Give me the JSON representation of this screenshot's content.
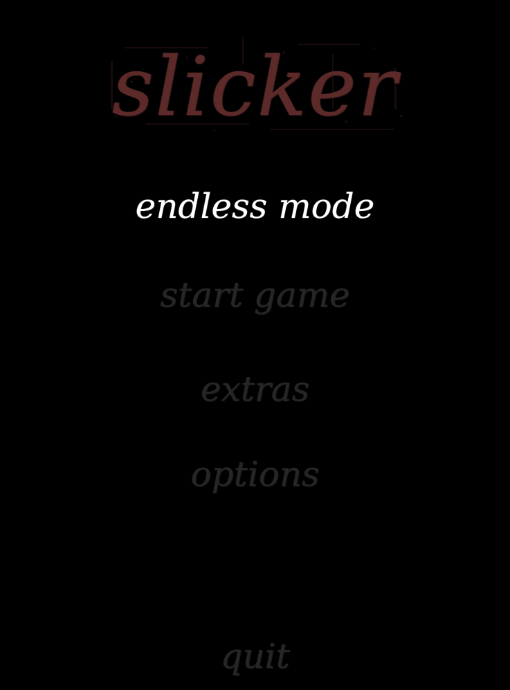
{
  "game": {
    "title": "slicker",
    "title_color": "#5c2a29",
    "menu": [
      {
        "label": "endless mode",
        "state": "selected",
        "color": "#ffffff"
      },
      {
        "label": "start game",
        "state": "normal",
        "color": "#262626"
      },
      {
        "label": "extras",
        "state": "normal",
        "color": "#262626"
      },
      {
        "label": "options",
        "state": "normal",
        "color": "#262626"
      },
      {
        "label": "quit",
        "state": "normal",
        "color": "#262626"
      }
    ]
  }
}
